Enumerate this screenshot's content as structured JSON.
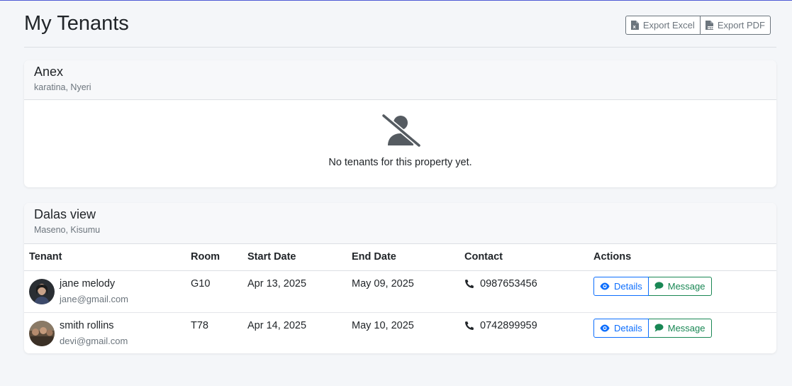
{
  "page": {
    "title": "My Tenants"
  },
  "export": {
    "excel_label": "Export Excel",
    "pdf_label": "Export PDF"
  },
  "properties": [
    {
      "name": "Anex",
      "location": "karatina, Nyeri",
      "empty_message": "No tenants for this property yet."
    },
    {
      "name": "Dalas view",
      "location": "Maseno, Kisumu",
      "columns": [
        "Tenant",
        "Room",
        "Start Date",
        "End Date",
        "Contact",
        "Actions"
      ],
      "tenants": [
        {
          "name": "jane melody",
          "email": "jane@gmail.com",
          "room": "G10",
          "start_date": "Apr 13, 2025",
          "end_date": "May 09, 2025",
          "phone": "0987653456",
          "details_label": "Details",
          "message_label": "Message"
        },
        {
          "name": "smith rollins",
          "email": "devi@gmail.com",
          "room": "T78",
          "start_date": "Apr 14, 2025",
          "end_date": "May 10, 2025",
          "phone": "0742899959",
          "details_label": "Details",
          "message_label": "Message"
        }
      ]
    }
  ],
  "colors": {
    "primary": "#0d6efd",
    "success": "#198754",
    "secondary": "#6c757d",
    "background": "#f4f6f9"
  }
}
